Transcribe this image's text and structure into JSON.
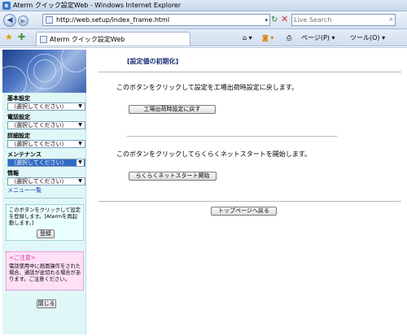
{
  "window": {
    "title": "Aterm クイック設定Web - Windows Internet Explorer"
  },
  "address_bar": {
    "url": "http://web.setup/index_frame.html",
    "search_placeholder": "Live Search"
  },
  "tabs": [
    {
      "label": "Aterm クイック設定Web"
    }
  ],
  "toolbar": {
    "page_menu": "ページ(P) ▾",
    "tools_menu": "ツール(O) ▾"
  },
  "sidebar": {
    "menus": [
      {
        "label": "基本設定",
        "value": "（選択してください）"
      },
      {
        "label": "電話設定",
        "value": "（選択してください）"
      },
      {
        "label": "詳細設定",
        "value": "（選択してください）"
      },
      {
        "label": "メンテナンス",
        "value": "（選択してください）",
        "selected": true
      },
      {
        "label": "情報",
        "value": "（選択してください）"
      }
    ],
    "menu_list_link": "メニュー一覧",
    "register_box": {
      "text": "このボタンをクリックして設定を登録します。[Atermを再起動します。]",
      "button": "登録"
    },
    "warning_box": {
      "title": "<ご注意>",
      "text": "電話使用中に画面操作をされた場合、通話が途切れる場合があります。ご注意ください。"
    },
    "close_button": "閉じる"
  },
  "main": {
    "title": "[設定値の初期化]",
    "factory_reset": {
      "description": "このボタンをクリックして設定を工場出荷時設定に戻します。",
      "button": "工場出荷時設定に戻す"
    },
    "easy_start": {
      "description": "このボタンをクリックしてらくらくネットスタートを開始します。",
      "button": "らくらくネットスタート開始"
    },
    "top_button": "トップページへ戻る"
  },
  "colors": {
    "sidebar_bg": "#dff7f7",
    "title_text": "#1b2f7a",
    "selected_menu": "#316ac5",
    "warning_bg": "#ffe0f6",
    "warning_title": "#d0309c"
  }
}
